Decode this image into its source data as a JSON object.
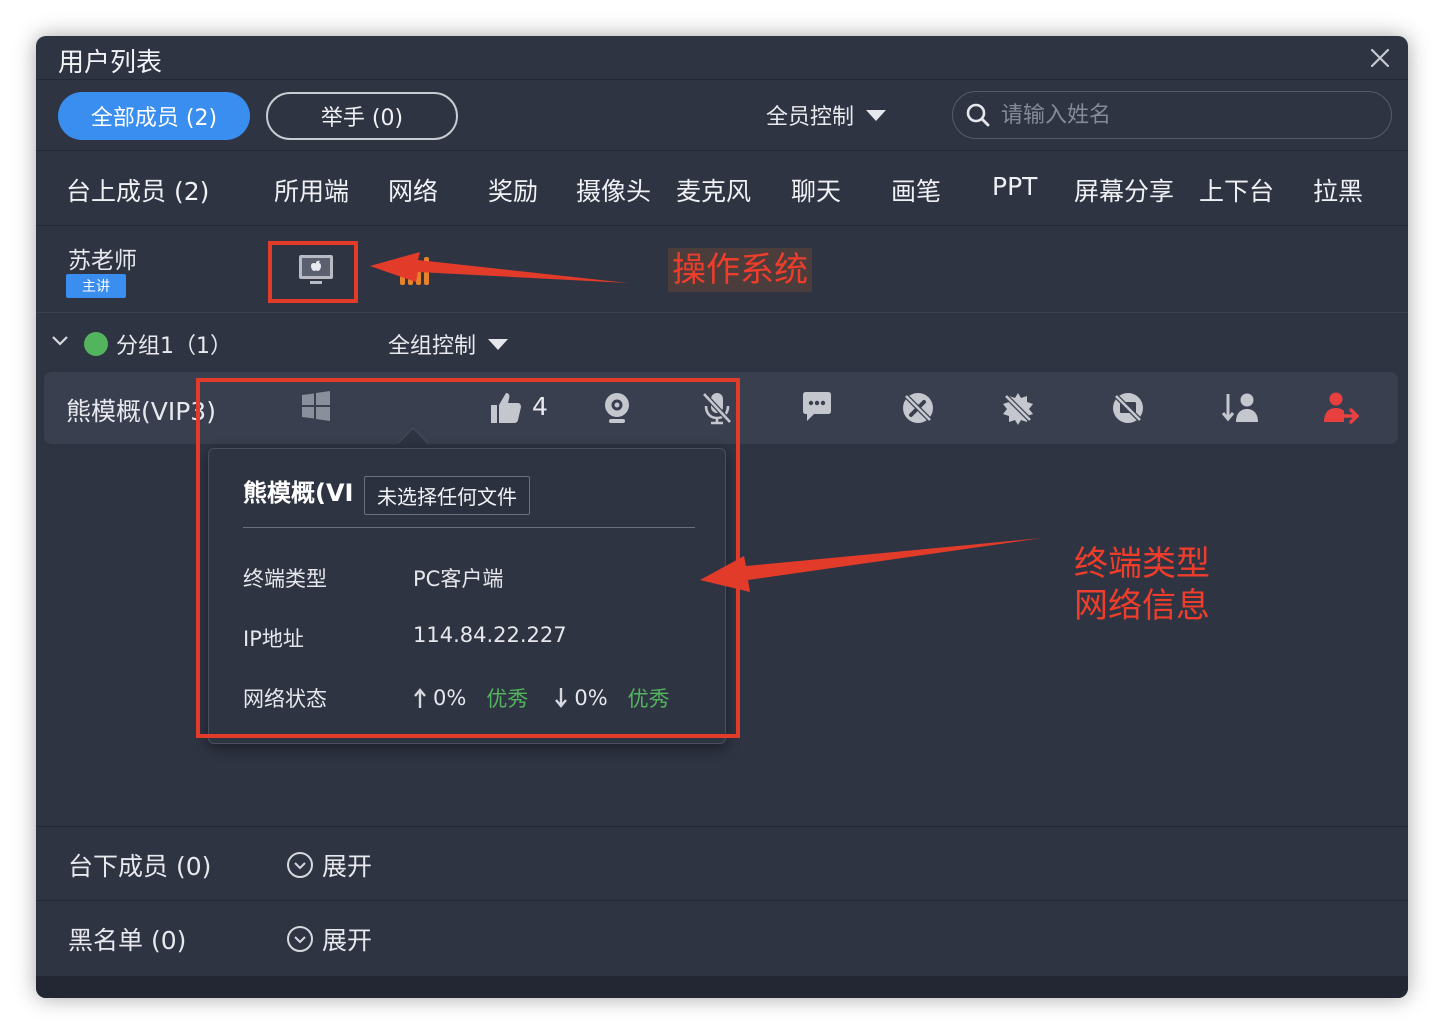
{
  "window": {
    "title": "用户列表"
  },
  "toolbar": {
    "tab_all": "全部成员 (2)",
    "tab_hand": "举手 (0)",
    "all_control": "全员控制",
    "search_placeholder": "请输入姓名"
  },
  "columns": [
    "台上成员 (2)",
    "所用端",
    "网络",
    "奖励",
    "摄像头",
    "麦克风",
    "聊天",
    "画笔",
    "PPT",
    "屏幕分享",
    "上下台",
    "拉黑"
  ],
  "teacher": {
    "name": "苏老师",
    "badge": "主讲"
  },
  "group": {
    "name": "分组1（1）",
    "control": "全组控制"
  },
  "member": {
    "name": "熊模概(VIP3)",
    "likes": "4"
  },
  "popup": {
    "title": "熊模概(VI",
    "tooltip": "未选择任何文件",
    "terminal_label": "终端类型",
    "terminal_value": "PC客户端",
    "ip_label": "IP地址",
    "ip_value": "114.84.22.227",
    "net_label": "网络状态",
    "up_value": "0%",
    "up_quality": "优秀",
    "down_value": "0%",
    "down_quality": "优秀"
  },
  "sections": {
    "offstage_label": "台下成员 (0)",
    "offstage_expand": "展开",
    "blacklist_label": "黑名单 (0)",
    "blacklist_expand": "展开"
  },
  "annotations": {
    "os": "操作系统",
    "terminal_line1": "终端类型",
    "terminal_line2": "网络信息"
  },
  "colors": {
    "accent": "#3a8ef0",
    "good": "#52b45c",
    "annotation": "#e33b2a",
    "kick": "#e8403f"
  }
}
